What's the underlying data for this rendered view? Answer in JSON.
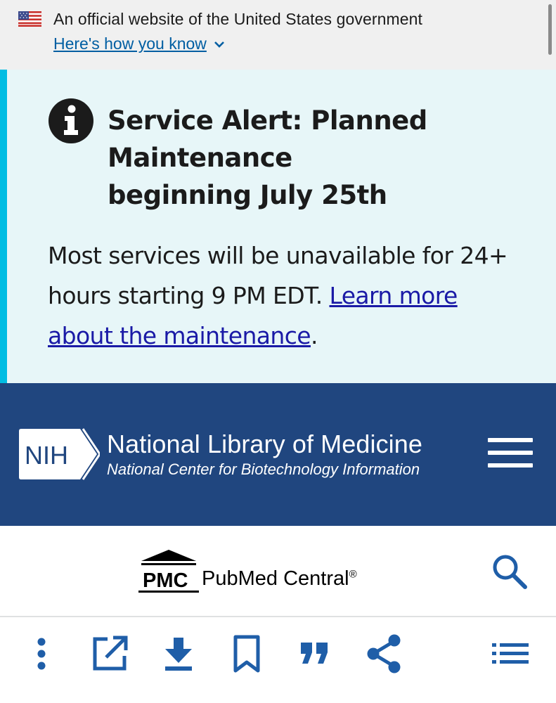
{
  "gov_banner": {
    "text": "An official website of the United States government",
    "link_label": "Here's how you know"
  },
  "alert": {
    "heading": "Service Alert: Planned Maintenance beginning July 25th",
    "body_text": "Most services will be unavailable for 24+ hours starting 9 PM EDT.",
    "link_text": "Learn more about the maintenance",
    "trailing": "."
  },
  "header": {
    "logo_text": "NIH",
    "title": "National Library of Medicine",
    "subtitle": "National Center for Biotechnology Information"
  },
  "pmc": {
    "mark_text": "PMC",
    "name": "PubMed Central",
    "registered": "®"
  },
  "colors": {
    "gov_banner_bg": "#f0f0f0",
    "link_blue": "#005ea2",
    "alert_bg": "#e7f6f8",
    "alert_bar": "#00bde3",
    "header_bg": "#20467f",
    "toolbar_icon": "#1f5ea8"
  },
  "toolbar": {
    "icons": [
      "more-vertical-icon",
      "open-external-icon",
      "download-icon",
      "bookmark-icon",
      "cite-quote-icon",
      "share-icon",
      "list-icon"
    ]
  }
}
